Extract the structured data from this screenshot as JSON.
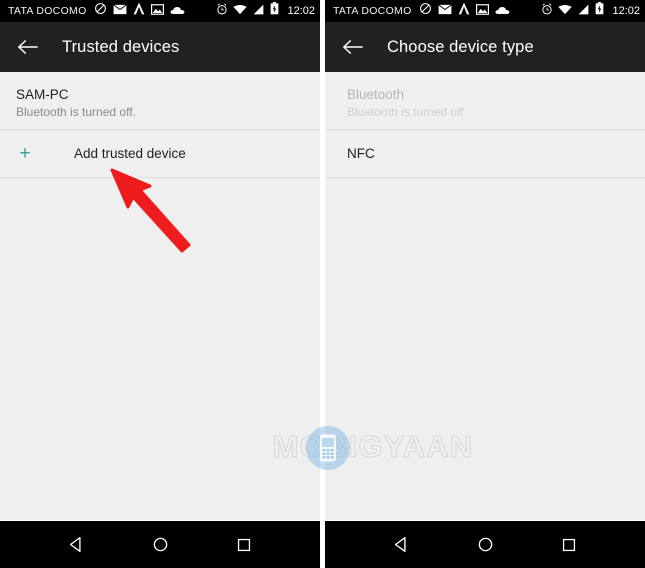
{
  "status_bar": {
    "carrier": "TATA DOCOMO",
    "clock": "12:02",
    "icons_left": [
      "mute-icon",
      "mail-icon",
      "triangle-app-icon",
      "photo-icon",
      "cloud-icon"
    ],
    "icons_right": [
      "alarm-icon",
      "wifi-icon",
      "signal-icon",
      "battery-charging-icon"
    ]
  },
  "left_screen": {
    "app_bar": {
      "back": "back-arrow-icon",
      "title": "Trusted devices"
    },
    "rows": [
      {
        "title": "SAM-PC",
        "subtitle": "Bluetooth is turned off.",
        "disabled": false
      }
    ],
    "add_row": {
      "icon": "+",
      "label": "Add trusted device"
    }
  },
  "right_screen": {
    "app_bar": {
      "back": "back-arrow-icon",
      "title": "Choose device type"
    },
    "rows": [
      {
        "title": "Bluetooth",
        "subtitle": "Bluetooth is turned off",
        "disabled": true
      },
      {
        "title": "NFC",
        "subtitle": "",
        "disabled": false
      }
    ]
  },
  "nav_bar": {
    "back": "nav-back-icon",
    "home": "nav-home-icon",
    "recents": "nav-recents-icon"
  },
  "annotation": {
    "arrow_color": "#ee1c1c",
    "points_to": "Add trusted device"
  },
  "watermark": {
    "text_before": "M",
    "text_after": "BIGYAAN",
    "full_text": "MOBIGYAAN"
  },
  "colors": {
    "status_bar_bg": "#000000",
    "app_bar_bg": "#212121",
    "content_bg": "#efefef",
    "accent_plus": "#3a9e95",
    "divider": "#e0e0e0",
    "primary_text": "#212121",
    "secondary_text": "#8a8a8a",
    "disabled_text": "#b6b6b6"
  }
}
